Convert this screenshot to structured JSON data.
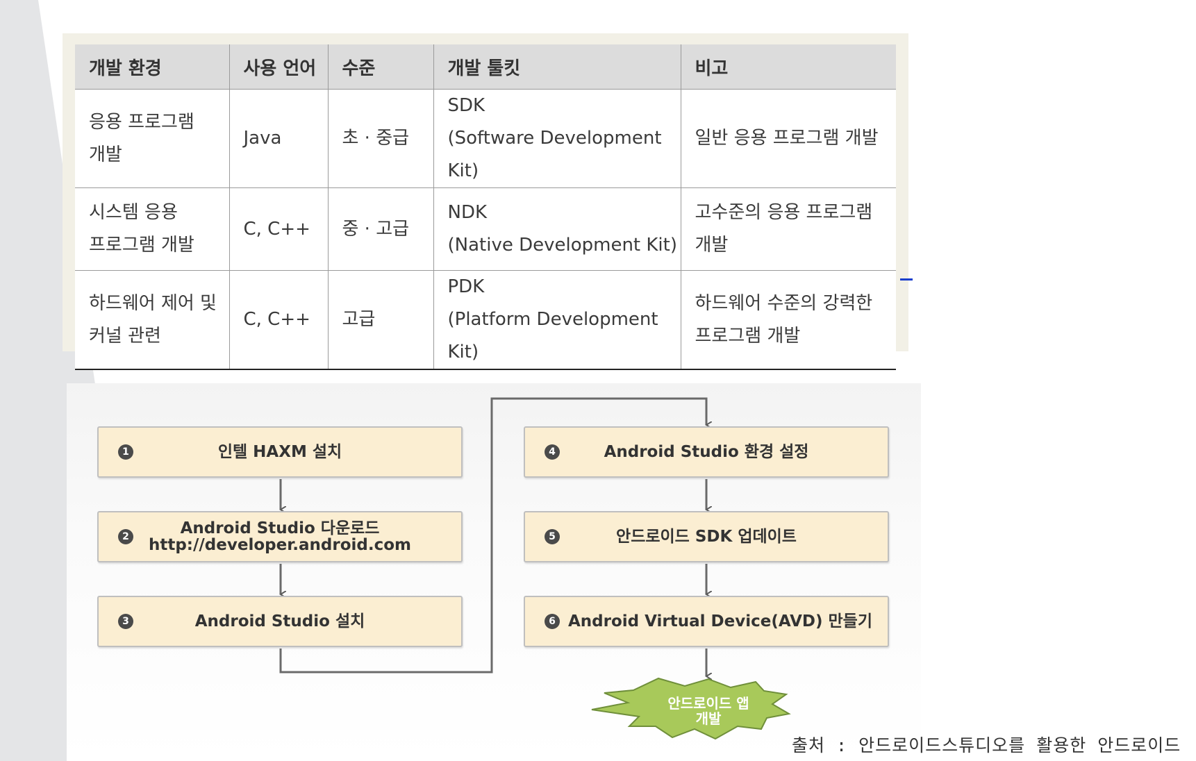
{
  "table": {
    "headers": [
      "개발 환경",
      "사용 언어",
      "수준",
      "개발 툴킷",
      "비고"
    ],
    "rows": [
      [
        "응용 프로그램\n개발",
        "Java",
        "초 · 중급",
        "SDK\n(Software Development Kit)",
        "일반 응용 프로그램 개발"
      ],
      [
        "시스템 응용\n프로그램 개발",
        "C, C++",
        "중 · 고급",
        "NDK\n(Native Development Kit)",
        "고수준의 응용 프로그램\n개발"
      ],
      [
        "하드웨어 제어 및\n커널 관련",
        "C, C++",
        "고급",
        "PDK\n(Platform Development Kit)",
        "하드웨어 수준의 강력한\n프로그램 개발"
      ]
    ]
  },
  "flow": {
    "steps": [
      {
        "num": "1",
        "line1": "인텔 HAXM 설치",
        "line2": ""
      },
      {
        "num": "2",
        "line1": "Android Studio 다운로드",
        "line2": "http://developer.android.com"
      },
      {
        "num": "3",
        "line1": "Android Studio 설치",
        "line2": ""
      },
      {
        "num": "4",
        "line1": "Android Studio 환경 설정",
        "line2": ""
      },
      {
        "num": "5",
        "line1": "안드로이드 SDK 업데이트",
        "line2": ""
      },
      {
        "num": "6",
        "line1": "Android Virtual Device(AVD) 만들기",
        "line2": ""
      }
    ],
    "final": {
      "line1": "안드로이드 앱",
      "line2": "개발",
      "color": "#a8c95a"
    }
  },
  "source": "출처 : 안드로이드스튜디오를 활용한 안드로이드"
}
